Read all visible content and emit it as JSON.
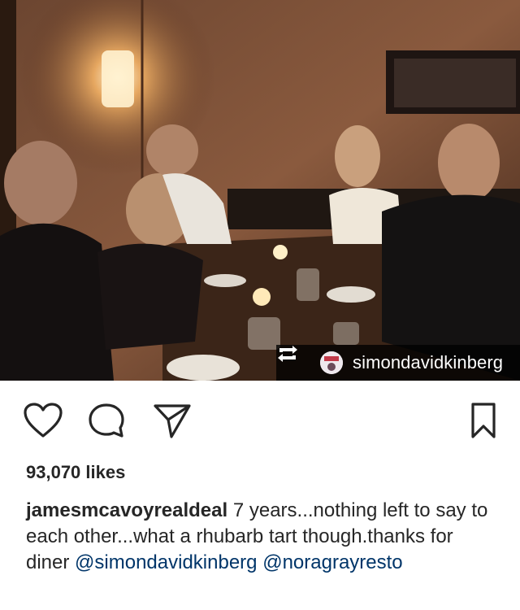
{
  "post": {
    "repost_username": "simondavidkinberg",
    "likes_text": "93,070 likes",
    "caption": {
      "username": "jamesmcavoyrealdeal",
      "text": "7 years...nothing left to say to each other...what a rhubarb tart though.thanks for diner",
      "mention_1": "@simondavidkinberg",
      "mention_2": "@noragrayresto"
    }
  },
  "icons": {
    "like": "heart-icon",
    "comment": "comment-icon",
    "share": "paper-plane-icon",
    "save": "bookmark-icon",
    "repost": "repost-icon"
  },
  "colors": {
    "text": "#262626",
    "mention": "#003569",
    "overlay": "#000000"
  }
}
